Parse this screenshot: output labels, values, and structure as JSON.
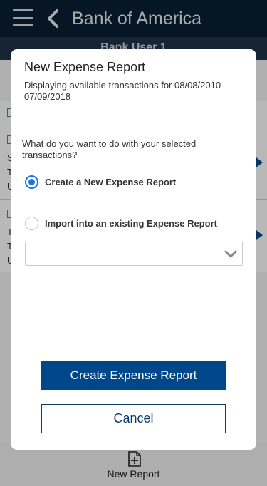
{
  "header": {
    "title": "Bank of America",
    "menu_icon": "hamburger-icon",
    "back_icon": "chevron-left-icon"
  },
  "subheader": {
    "title": "Bank User 1"
  },
  "underlying": {
    "row1_lines": [
      "S",
      "T",
      "U"
    ],
    "row2_lines": [
      "T",
      "T",
      "U"
    ]
  },
  "bottom_bar": {
    "new_report_label": "New Report",
    "new_report_icon": "add-document-icon"
  },
  "modal": {
    "title": "New Expense Report",
    "subtitle": "Displaying available transactions for 08/08/2010 - 07/09/2018",
    "question": "What do you want to do with your selected transactions?",
    "options": [
      {
        "label": "Create a New Expense Report",
        "checked": true
      },
      {
        "label": "Import into an existing Expense Report",
        "checked": false
      }
    ],
    "report_select": {
      "value": "––––",
      "icon": "chevron-down-icon"
    },
    "primary_button": "Create Expense Report",
    "secondary_button": "Cancel"
  },
  "colors": {
    "header_bg": "#0a1f33",
    "primary": "#00478a",
    "radio_accent": "#1a73e8"
  }
}
